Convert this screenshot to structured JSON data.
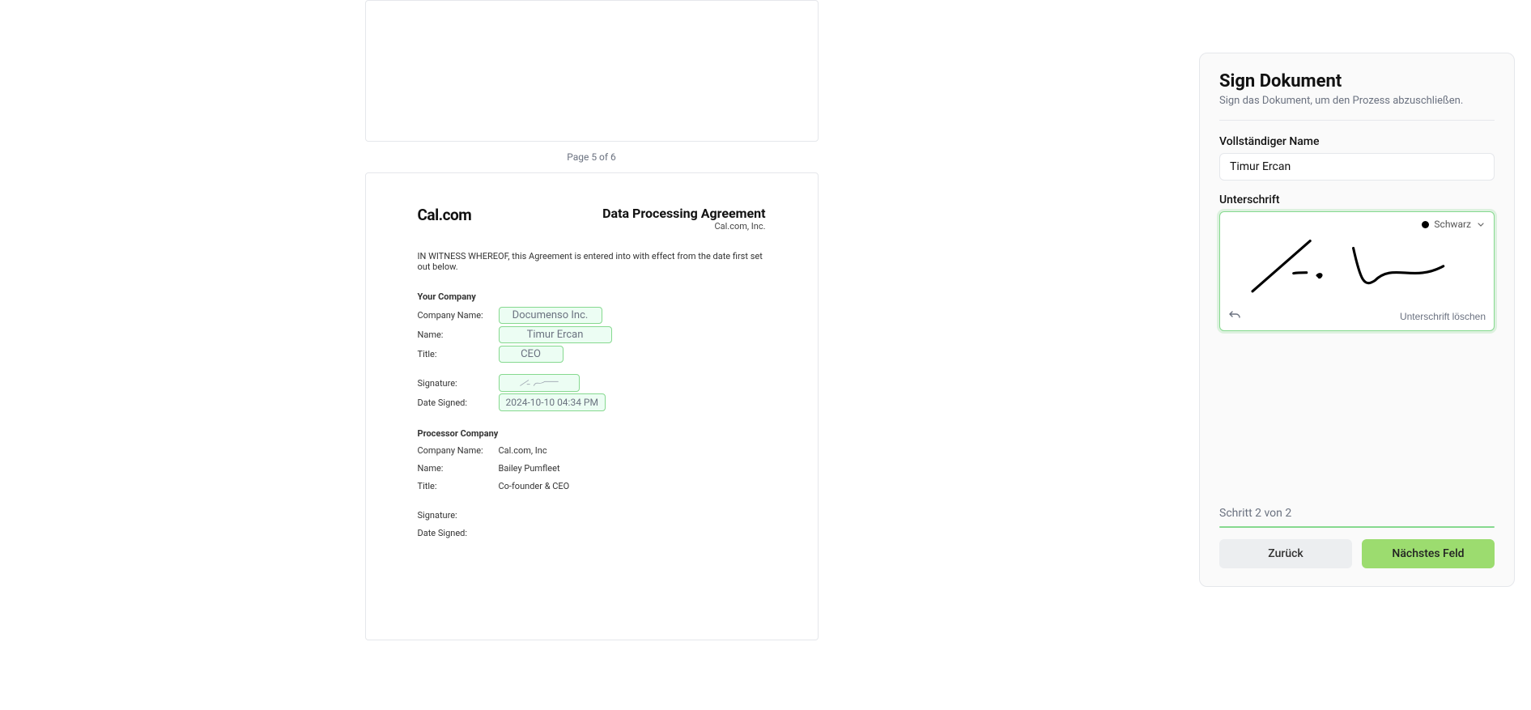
{
  "viewer": {
    "page_label": "Page 5 of 6"
  },
  "document": {
    "brand": "Cal.com",
    "title": "Data Processing Agreement",
    "subtitle": "Cal.com, Inc.",
    "witness_text": "IN WITNESS WHEREOF, this Agreement is entered into with effect from the date first set out below.",
    "your_company": {
      "heading": "Your Company",
      "labels": {
        "company_name": "Company Name:",
        "name": "Name:",
        "title": "Title:",
        "signature": "Signature:",
        "date_signed": "Date Signed:"
      },
      "values": {
        "company_name": "Documenso Inc.",
        "name": "Timur Ercan",
        "title": "CEO",
        "date_signed": "2024-10-10 04:34 PM"
      }
    },
    "processor_company": {
      "heading": "Processor Company",
      "labels": {
        "company_name": "Company Name:",
        "name": "Name:",
        "title": "Title:",
        "signature": "Signature:",
        "date_signed": "Date Signed:"
      },
      "values": {
        "company_name": "Cal.com, Inc",
        "name": "Bailey Pumfleet",
        "title": "Co-founder & CEO"
      }
    }
  },
  "sidebar": {
    "title": "Sign Dokument",
    "subtitle": "Sign das Dokument, um den Prozess abzuschließen.",
    "full_name_label": "Vollständiger Name",
    "full_name_value": "Timur Ercan",
    "signature_label": "Unterschrift",
    "color_label": "Schwarz",
    "clear_label": "Unterschrift löschen",
    "step_label": "Schritt 2 von 2",
    "back_button": "Zurück",
    "next_button": "Nächstes Feld"
  },
  "colors": {
    "field_bg": "#ecfdf3",
    "field_border": "#86d98f",
    "primary_btn": "#9cdc6f"
  }
}
